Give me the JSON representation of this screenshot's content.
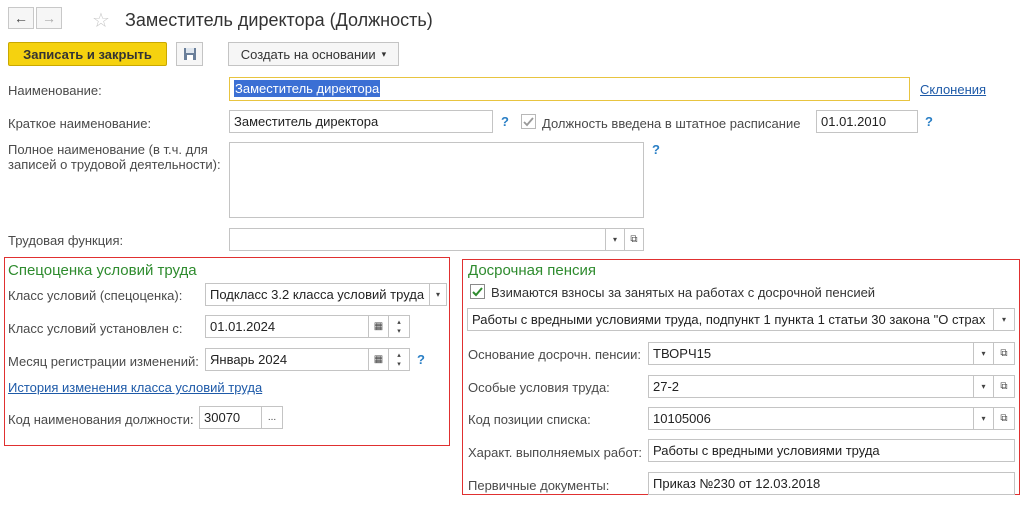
{
  "window": {
    "title": "Заместитель директора (Должность)"
  },
  "toolbar": {
    "save_close_label": "Записать и закрыть",
    "create_based_label": "Создать на основании",
    "dropdown_glyph": "▾"
  },
  "form": {
    "name_label": "Наименование:",
    "name_value": "Заместитель директора",
    "declension_link": "Склонения",
    "short_name_label": "Краткое наименование:",
    "short_name_value": "Заместитель директора",
    "help_mark": "?",
    "staffing_checkbox_label": "Должность введена в штатное расписание",
    "staffing_date": "01.01.2010",
    "full_name_label_line1": "Полное наименование (в т.ч. для",
    "full_name_label_line2": "записей о трудовой деятельности):",
    "full_name_value": "",
    "labor_function_label": "Трудовая функция:",
    "labor_function_value": ""
  },
  "special_assessment": {
    "title": "Спецоценка условий труда",
    "class_label": "Класс условий (спецоценка):",
    "class_value": "Подкласс 3.2 класса условий труда",
    "class_set_from_label": "Класс условий установлен с:",
    "class_set_from_value": "01.01.2024",
    "registration_month_label": "Месяц регистрации изменений:",
    "registration_month_value": "Январь 2024",
    "history_link": "История изменения класса условий труда",
    "position_code_label": "Код наименования должности:",
    "position_code_value": "30070",
    "select_button": "..."
  },
  "early_pension": {
    "title": "Досрочная пенсия",
    "contributions_checkbox_label": "Взимаются взносы за занятых на работах с досрочной пенсией",
    "contributions_checked": true,
    "work_type_value": "Работы с вредными условиями труда, подпункт 1 пункта 1 статьи 30 закона \"О страх",
    "basis_label": "Основание досрочн. пенсии:",
    "basis_value": "ТВОРЧ15",
    "special_conditions_label": "Особые условия труда:",
    "special_conditions_value": "27-2",
    "list_position_code_label": "Код позиции списка:",
    "list_position_code_value": "10105006",
    "work_character_label": "Характ. выполняемых работ:",
    "work_character_value": "Работы с вредными условиями труда",
    "primary_docs_label": "Первичные документы:",
    "primary_docs_value": "Приказ №230 от 12.03.2018"
  },
  "colors": {
    "accent_yellow": "#f5d20f",
    "group_title_green": "#2e8b2e",
    "highlight_border": "#e03030",
    "link_blue": "#1e5aa8",
    "selection_blue": "#3b6fd4"
  }
}
